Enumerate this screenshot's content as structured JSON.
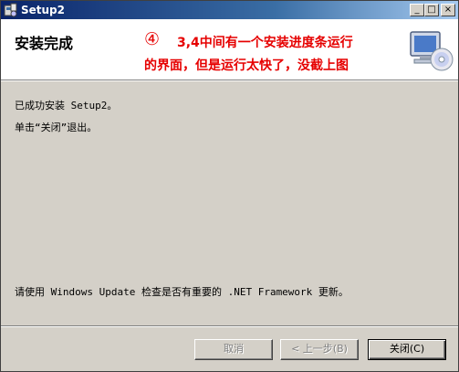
{
  "window": {
    "title": "Setup2",
    "controls": {
      "minimize": "_",
      "maximize": "□",
      "close": "×"
    }
  },
  "header": {
    "title": "安装完成",
    "annotation": {
      "number": "④",
      "line1": "3,4中间有一个安装进度条运行",
      "line2": "的界面，但是运行太快了，没截上图",
      "color": "#e60000"
    },
    "icon": "computer-disc-icon"
  },
  "body": {
    "line1": "已成功安装 Setup2。",
    "line2": "单击“关闭”退出。",
    "line3": "请使用 Windows Update 检查是否有重要的 .NET Framework 更新。"
  },
  "buttons": {
    "cancel": "取消",
    "back": "< 上一步(B)",
    "close": "关闭(C)"
  }
}
